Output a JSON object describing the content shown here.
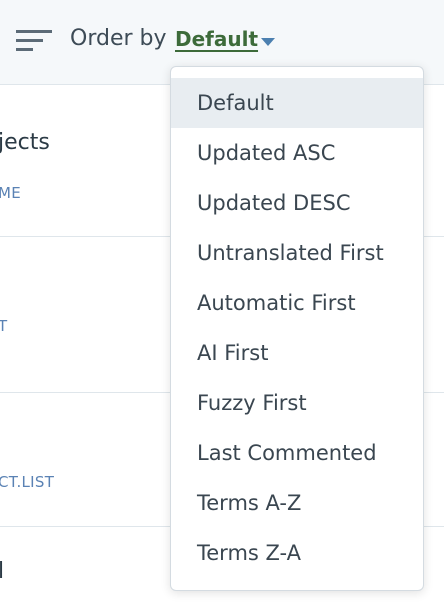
{
  "toolbar": {
    "sort_icon": "sort-lines-icon",
    "order_label": "Order by",
    "order_value": "Default",
    "caret_icon": "caret-down-icon",
    "accent_color": "#3d6b3a"
  },
  "rows": [
    {
      "title": "jects",
      "subtitle": "ME"
    },
    {
      "title": "",
      "subtitle": "T"
    },
    {
      "title": "",
      "subtitle": "CT.LIST"
    },
    {
      "title": "l",
      "subtitle": ""
    }
  ],
  "dropdown": {
    "selected": "Default",
    "items": [
      "Default",
      "Updated ASC",
      "Updated DESC",
      "Untranslated First",
      "Automatic First",
      "AI First",
      "Fuzzy First",
      "Last Commented",
      "Terms A-Z",
      "Terms Z-A"
    ]
  }
}
